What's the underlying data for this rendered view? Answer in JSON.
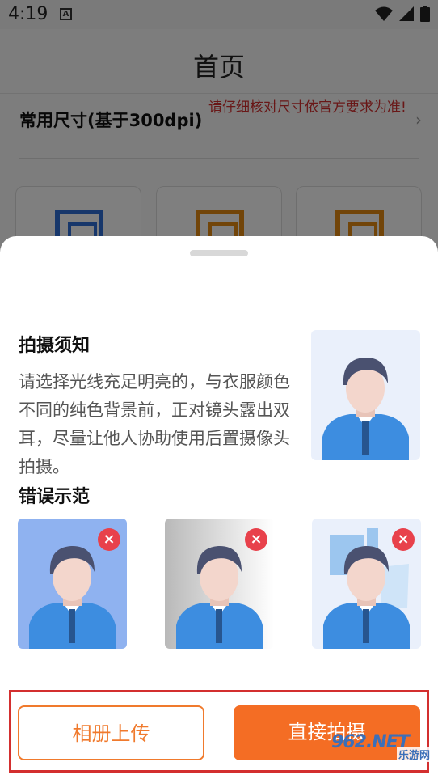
{
  "status_bar": {
    "time": "4:19",
    "notification_icon": "A"
  },
  "page": {
    "title": "首页",
    "size_row": {
      "title": "常用尺寸(基于300dpi)",
      "note": "请仔细核对尺寸依官方要求为准!"
    }
  },
  "sheet": {
    "notice_title": "拍摄须知",
    "notice_body": "请选择光线充足明亮的，与衣服颜色不同的纯色背景前，正对镜头露出双耳，尽量让他人协助使用后置摄像头拍摄。",
    "wrong_title": "错误示范",
    "buttons": {
      "album": "相册上传",
      "shoot": "直接拍摄"
    }
  },
  "watermark": {
    "text": "962.NET",
    "sub": "乐游网"
  },
  "colors": {
    "accent": "#f46d24",
    "error": "#e8414b",
    "highlight_frame": "#d32f2f"
  }
}
